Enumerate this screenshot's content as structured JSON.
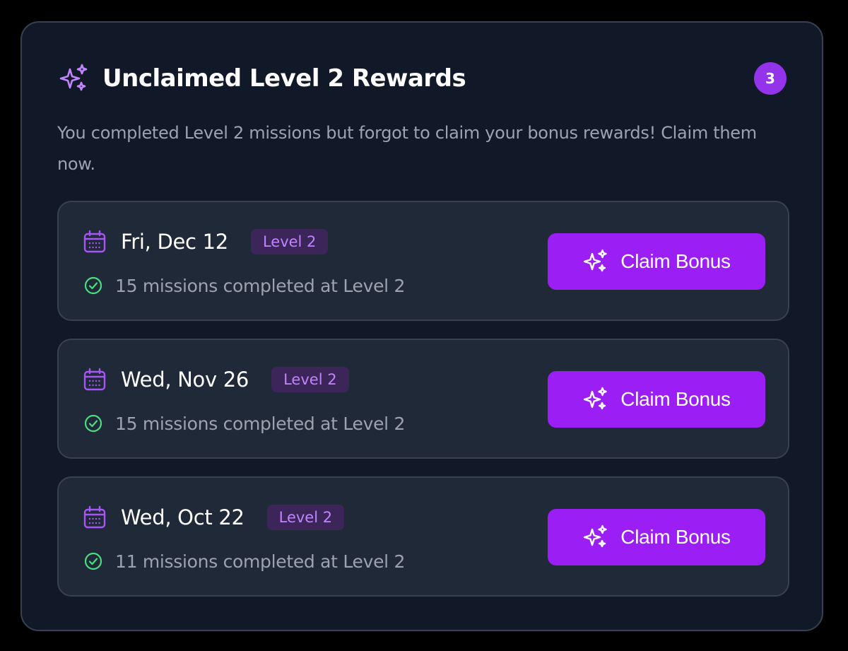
{
  "panel": {
    "icon": "sparkles-icon",
    "title": "Unclaimed Level 2 Rewards",
    "count": "3",
    "description": "You completed Level 2 missions but forgot to claim your bonus rewards! Claim them now."
  },
  "rewards": [
    {
      "date": "Fri, Dec 12",
      "level": "Level 2",
      "missions": "15 missions completed at Level 2",
      "button_label": "Claim Bonus"
    },
    {
      "date": "Wed, Nov 26",
      "level": "Level 2",
      "missions": "15 missions completed at Level 2",
      "button_label": "Claim Bonus"
    },
    {
      "date": "Wed, Oct 22",
      "level": "Level 2",
      "missions": "11 missions completed at Level 2",
      "button_label": "Claim Bonus"
    }
  ],
  "colors": {
    "background": "#000000",
    "card": "#111827",
    "row": "#1f2937",
    "border": "#374151",
    "accent": "#9333ea",
    "button": "#9b1ff5",
    "chip_bg": "#3b2559",
    "chip_text": "#c084fc",
    "success": "#4ade80",
    "muted_text": "#9ca3af"
  },
  "icons": {
    "header": "sparkles-icon",
    "date": "calendar-icon",
    "status": "check-circle-icon",
    "button": "sparkles-icon"
  }
}
